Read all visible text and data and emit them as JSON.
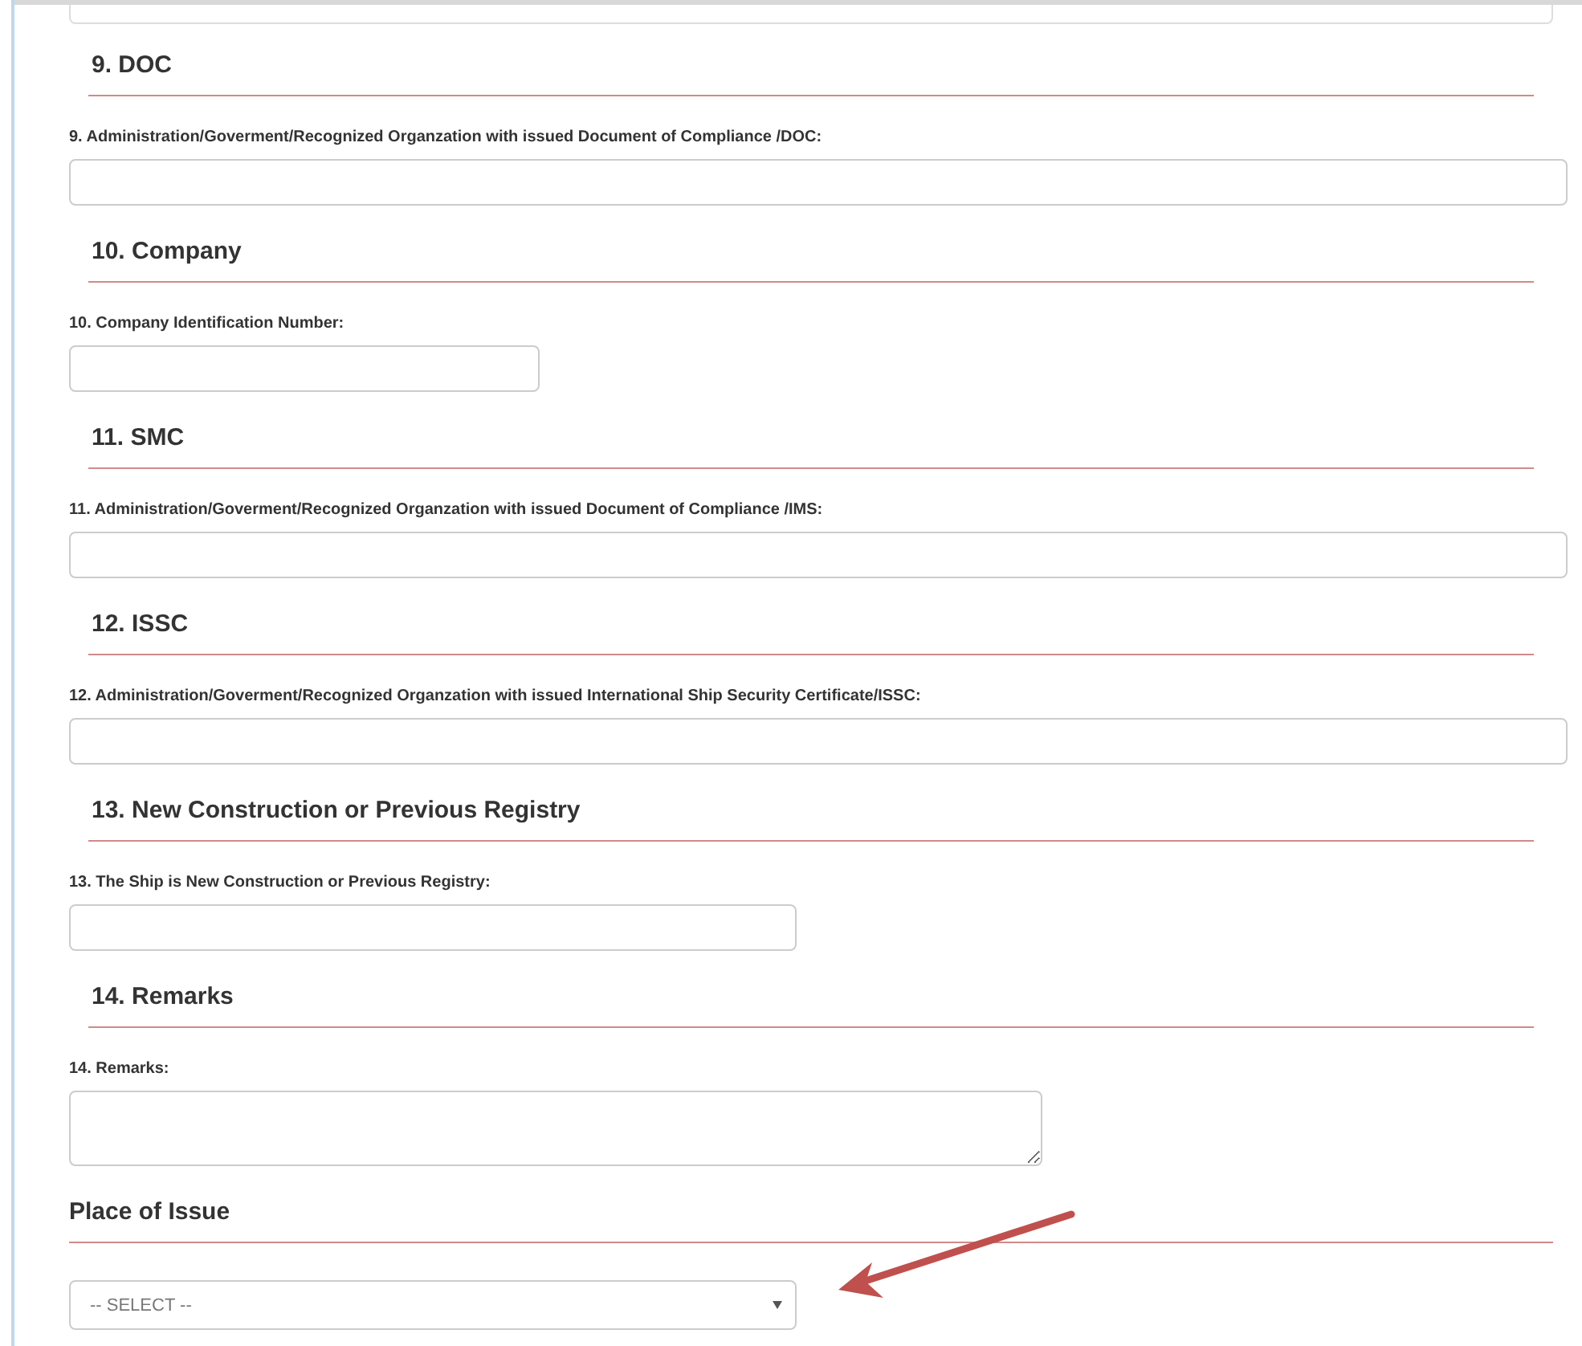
{
  "sections": [
    {
      "kind": "numbered",
      "heading": "9. DOC",
      "label": "9. Administration/Goverment/Recognized Organzation with issued Document of Compliance /DOC:",
      "field": {
        "kind": "input"
      }
    },
    {
      "kind": "numbered",
      "heading": "10. Company",
      "label": "10. Company Identification Number:",
      "field": {
        "kind": "input"
      }
    },
    {
      "kind": "numbered",
      "heading": "11. SMC",
      "label": "11. Administration/Goverment/Recognized Organzation with issued Document of Compliance /IMS:",
      "field": {
        "kind": "input"
      }
    },
    {
      "kind": "numbered",
      "heading": "12. ISSC",
      "label": "12. Administration/Goverment/Recognized Organzation with issued International Ship Security Certificate/ISSC:",
      "field": {
        "kind": "input"
      }
    },
    {
      "kind": "numbered",
      "heading": "13. New Construction or Previous Registry",
      "label": "13. The Ship is New Construction or Previous Registry:",
      "field": {
        "kind": "input"
      }
    },
    {
      "kind": "numbered",
      "heading": "14. Remarks",
      "label": "14. Remarks:",
      "field": {
        "kind": "textarea"
      }
    },
    {
      "kind": "plain",
      "heading": "Place of Issue",
      "field": {
        "kind": "select",
        "value": "-- SELECT --"
      }
    }
  ]
}
